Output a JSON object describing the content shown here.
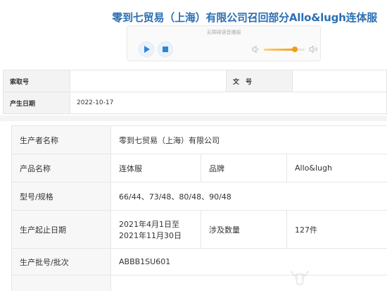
{
  "page": {
    "title": "零到七贸易（上海）有限公司召回部分Allo&lugh连体服"
  },
  "player": {
    "hint": "无障碍语音播报",
    "volume_fraction": 0.75
  },
  "meta": {
    "index_label": "索取号",
    "index_value": "",
    "doc_label": "文　号",
    "doc_value": "",
    "date_label": "产生日期",
    "date_value": "2022-10-17"
  },
  "details": {
    "producer_label": "生产者名称",
    "producer_value": "零到七贸易（上海）有限公司",
    "product_label": "产品名称",
    "product_value": "连体服",
    "brand_label": "品牌",
    "brand_value": "Allo&lugh",
    "model_label": "型号/规格",
    "model_value": "66/44、73/48、80/48、90/48",
    "period_label": "生产起止日期",
    "period_line1": "2021年4月1日至",
    "period_line2": "2021年11月30日",
    "qty_label": "涉及数量",
    "qty_value": "127件",
    "batch_label": "生产批号/批次",
    "batch_value": "ABBB1SU601"
  },
  "icons": {
    "play": "play-icon",
    "stop": "stop-icon",
    "volume_low": "volume-low-icon",
    "volume_high": "volume-high-icon",
    "watermark": "bull-logo-icon"
  },
  "colors": {
    "title": "#2c6fb3",
    "player_button": "#2e86d6",
    "slider": "#f29b1d"
  }
}
